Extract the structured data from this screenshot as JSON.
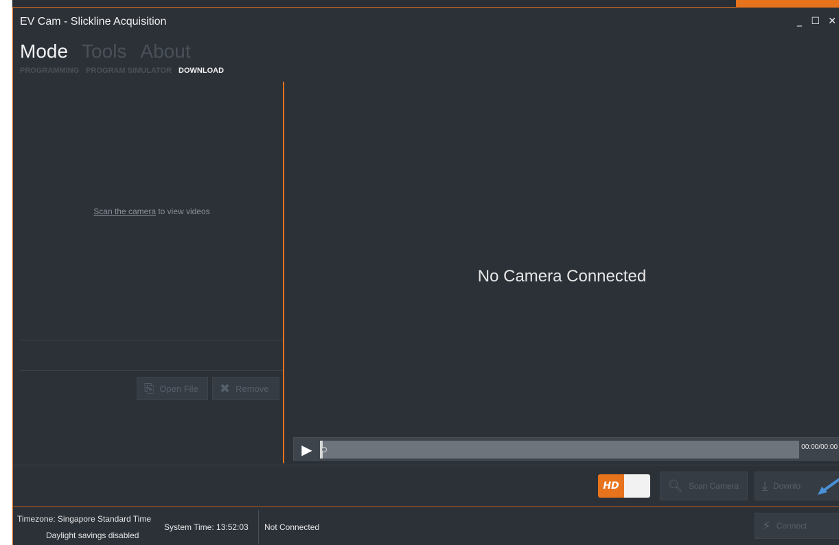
{
  "window": {
    "title": "EV Cam - Slickline Acquisition",
    "controls": {
      "minimize": "_",
      "maximize": "☐",
      "close": "✕"
    }
  },
  "menu": {
    "items": [
      {
        "label": "Mode",
        "active": true
      },
      {
        "label": "Tools",
        "active": false
      },
      {
        "label": "About",
        "active": false
      }
    ],
    "subitems": [
      {
        "label": "PROGRAMMING",
        "active": false
      },
      {
        "label": "PROGRAM SIMULATOR",
        "active": false
      },
      {
        "label": "DOWNLOAD",
        "active": true
      }
    ]
  },
  "left_pane": {
    "scan_link": "Scan the camera",
    "scan_suffix": " to view videos",
    "open_file_label": "Open File",
    "remove_label": "Remove"
  },
  "video": {
    "no_camera": "No Camera Connected",
    "timecode": "00:00/00:00"
  },
  "toolbar": {
    "hd_label": "HD",
    "scan_label": "Scan Camera",
    "download_label": "Downlo",
    "connect_label": "Connect"
  },
  "status": {
    "timezone": "Timezone: Singapore Standard Time",
    "dst": "Daylight savings disabled",
    "system_time": "System Time: 13:52:03",
    "connection": "Not Connected"
  },
  "colors": {
    "accent": "#e8731d",
    "background": "#2c3138",
    "annotation_arrow": "#4a90d9"
  }
}
